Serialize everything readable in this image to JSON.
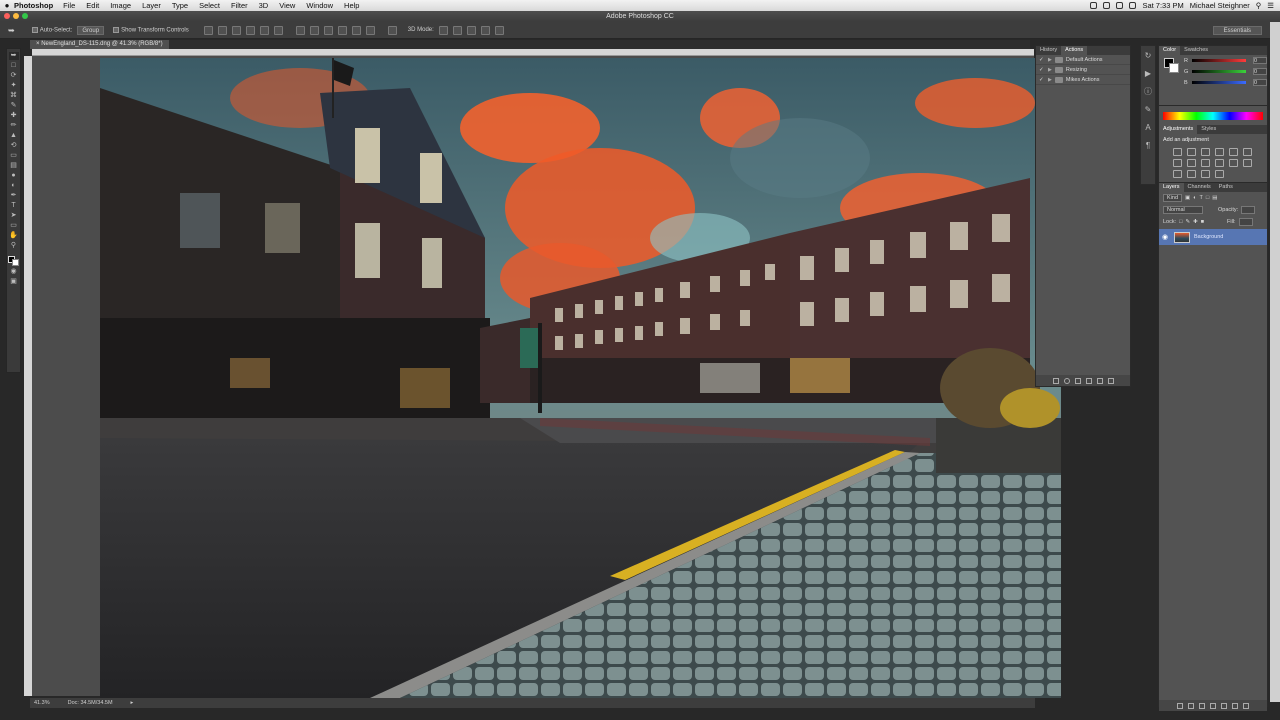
{
  "menubar": {
    "apple": "",
    "app_name": "Photoshop",
    "items": [
      "File",
      "Edit",
      "Image",
      "Layer",
      "Type",
      "Select",
      "Filter",
      "3D",
      "View",
      "Window",
      "Help"
    ],
    "clock": "Sat 7:33 PM",
    "user": "Michael Steighner"
  },
  "window": {
    "title": "Adobe Photoshop CC"
  },
  "options": {
    "auto_select": "Auto-Select:",
    "group": "Group",
    "show_transform": "Show Transform Controls",
    "mode_3d": "3D Mode:",
    "workspace": "Essentials"
  },
  "document": {
    "tab": "NewEngland_DS-115.dng @ 41.3% (RGB/8*)",
    "zoom": "41.3%",
    "doc_size": "Doc: 34.5M/34.5M"
  },
  "actions_panel": {
    "tabs": [
      "History",
      "Actions"
    ],
    "items": [
      "Default Actions",
      "Resizing",
      "Mikes Actions"
    ]
  },
  "color_panel": {
    "tabs": [
      "Color",
      "Swatches"
    ],
    "channels": [
      {
        "label": "R",
        "value": "0",
        "color": "#ff3b3b"
      },
      {
        "label": "G",
        "value": "0",
        "color": "#3bd13b"
      },
      {
        "label": "B",
        "value": "0",
        "color": "#3b6bff"
      }
    ]
  },
  "adjustments_panel": {
    "tabs": [
      "Adjustments",
      "Styles"
    ],
    "title": "Add an adjustment"
  },
  "layers_panel": {
    "tabs": [
      "Layers",
      "Channels",
      "Paths"
    ],
    "kind": "Kind",
    "blend": "Normal",
    "opacity_label": "Opacity:",
    "lock_label": "Lock:",
    "fill_label": "Fill:",
    "layer_name": "Background"
  },
  "colors": {
    "accent": "#5776b3",
    "panel": "#535353",
    "chrome": "#3d3d3d"
  }
}
